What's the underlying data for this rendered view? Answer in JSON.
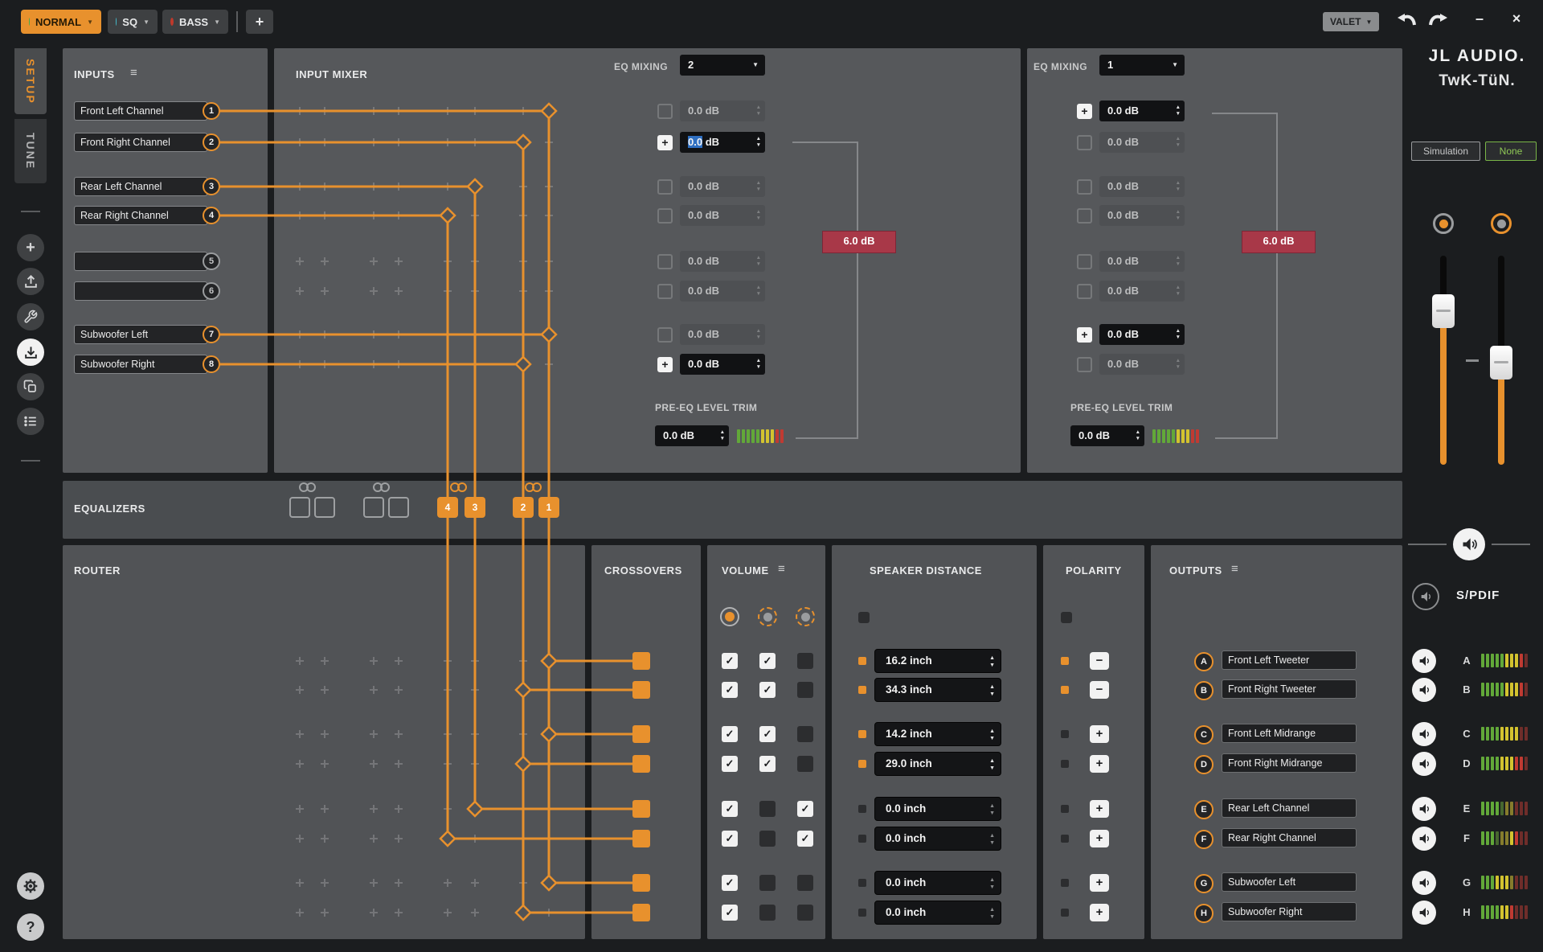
{
  "toolbar": {
    "presets": [
      {
        "label": "NORMAL",
        "dot_color": "#3faa4f",
        "active": true
      },
      {
        "label": "SQ",
        "dot_color": "#45b8c8",
        "active": false
      },
      {
        "label": "BASS",
        "dot_color": "#c0392b",
        "active": false
      }
    ],
    "add_label": "+",
    "valet_label": "VALET"
  },
  "sidebar": {
    "tabs": [
      {
        "label": "SETUP",
        "active": true
      },
      {
        "label": "TUNE",
        "active": false
      }
    ],
    "icons": [
      "add",
      "upload",
      "tools",
      "download",
      "copy",
      "list"
    ],
    "active_icon": "download",
    "bottom_icons": [
      "gear",
      "help"
    ],
    "help_glyph": "?"
  },
  "inputs": {
    "title": "INPUTS",
    "channels": [
      {
        "num": "1",
        "label": "Front Left Channel",
        "connected": true
      },
      {
        "num": "2",
        "label": "Front Right Channel",
        "connected": true
      },
      {
        "num": "3",
        "label": "Rear Left Channel",
        "connected": true
      },
      {
        "num": "4",
        "label": "Rear Right Channel",
        "connected": true
      },
      {
        "num": "5",
        "label": "",
        "connected": false
      },
      {
        "num": "6",
        "label": "",
        "connected": false
      },
      {
        "num": "7",
        "label": "Subwoofer Left",
        "connected": true
      },
      {
        "num": "8",
        "label": "Subwoofer Right",
        "connected": true
      }
    ]
  },
  "mixer": {
    "title": "INPUT MIXER",
    "eq_mixing_label": "EQ MIXING",
    "group_a": {
      "eq_mixing_value": "2",
      "rows": [
        {
          "checked": false,
          "value": "0.0 dB"
        },
        {
          "checked": true,
          "value": "0.0 dB"
        },
        {
          "checked": false,
          "value": "0.0 dB"
        },
        {
          "checked": false,
          "value": "0.0 dB"
        },
        {
          "checked": false,
          "value": "0.0 dB"
        },
        {
          "checked": false,
          "value": "0.0 dB"
        },
        {
          "checked": false,
          "value": "0.0 dB"
        },
        {
          "checked": true,
          "value": "0.0 dB"
        }
      ],
      "selected_num": "0.0",
      "selected_unit": " dB",
      "badge": "6.0 dB",
      "trim_label": "PRE-EQ LEVEL TRIM",
      "trim_value": "0.0 dB"
    },
    "group_b": {
      "eq_mixing_value": "1",
      "rows": [
        {
          "checked": true,
          "value": "0.0 dB"
        },
        {
          "checked": false,
          "value": "0.0 dB"
        },
        {
          "checked": false,
          "value": "0.0 dB"
        },
        {
          "checked": false,
          "value": "0.0 dB"
        },
        {
          "checked": false,
          "value": "0.0 dB"
        },
        {
          "checked": false,
          "value": "0.0 dB"
        },
        {
          "checked": true,
          "value": "0.0 dB"
        },
        {
          "checked": false,
          "value": "0.0 dB"
        }
      ],
      "badge": "6.0 dB",
      "trim_label": "PRE-EQ LEVEL TRIM",
      "trim_value": "0.0 dB"
    }
  },
  "equalizers": {
    "title": "EQUALIZERS",
    "bands": [
      "4",
      "3",
      "2",
      "1"
    ]
  },
  "router": {
    "title": "ROUTER",
    "input_to_eq": {
      "1": "EQ1",
      "2": "EQ2",
      "3": "EQ3",
      "4": "EQ4",
      "7": "EQ1",
      "8": "EQ2"
    },
    "eq_to_outputs": {
      "EQ1": [
        "A",
        "C",
        "G"
      ],
      "EQ2": [
        "B",
        "D",
        "H"
      ],
      "EQ3": [
        "E"
      ],
      "EQ4": [
        "F"
      ]
    }
  },
  "crossovers": {
    "title": "CROSSOVERS"
  },
  "volume": {
    "title": "VOLUME",
    "rows": [
      [
        true,
        true,
        false
      ],
      [
        true,
        true,
        false
      ],
      [
        true,
        true,
        false
      ],
      [
        true,
        true,
        false
      ],
      [
        true,
        false,
        true
      ],
      [
        true,
        false,
        true
      ],
      [
        true,
        false,
        false
      ],
      [
        true,
        false,
        false
      ]
    ],
    "check_glyph": "✓"
  },
  "distance": {
    "title": "SPEAKER DISTANCE",
    "rows": [
      {
        "value": "16.2 inch",
        "active": true
      },
      {
        "value": "34.3 inch",
        "active": true
      },
      {
        "value": "14.2 inch",
        "active": true
      },
      {
        "value": "29.0 inch",
        "active": true
      },
      {
        "value": "0.0 inch",
        "active": false
      },
      {
        "value": "0.0 inch",
        "active": false
      },
      {
        "value": "0.0 inch",
        "active": false
      },
      {
        "value": "0.0 inch",
        "active": false
      }
    ]
  },
  "polarity": {
    "title": "POLARITY",
    "rows": [
      {
        "sign": "−",
        "active": true
      },
      {
        "sign": "−",
        "active": true
      },
      {
        "sign": "+",
        "active": false
      },
      {
        "sign": "+",
        "active": false
      },
      {
        "sign": "+",
        "active": false
      },
      {
        "sign": "+",
        "active": false
      },
      {
        "sign": "+",
        "active": false
      },
      {
        "sign": "+",
        "active": false
      }
    ]
  },
  "outputs": {
    "title": "OUTPUTS",
    "rows": [
      {
        "letter": "A",
        "label": "Front Left Tweeter"
      },
      {
        "letter": "B",
        "label": "Front Right Tweeter"
      },
      {
        "letter": "C",
        "label": "Front Left Midrange"
      },
      {
        "letter": "D",
        "label": "Front Right Midrange"
      },
      {
        "letter": "E",
        "label": "Rear Left Channel"
      },
      {
        "letter": "F",
        "label": "Rear Right Channel"
      },
      {
        "letter": "G",
        "label": "Subwoofer Left"
      },
      {
        "letter": "H",
        "label": "Subwoofer Right"
      }
    ]
  },
  "right_panel": {
    "logo_line1": "JL AUDIO.",
    "logo_line2": "TwK-TüN.",
    "sim_label": "Simulation",
    "none_label": "None",
    "spdif_label": "S/PDIF",
    "accent_orange": "#e8912d",
    "meters": [
      {
        "letter": "A",
        "segments": [
          "#62a839",
          "#62a839",
          "#62a839",
          "#62a839",
          "#62a839",
          "#d3c32f",
          "#d3c32f",
          "#d3c32f",
          "#c03a32",
          "#6f2d2a"
        ]
      },
      {
        "letter": "B",
        "segments": [
          "#62a839",
          "#62a839",
          "#62a839",
          "#62a839",
          "#62a839",
          "#d3c32f",
          "#d3c32f",
          "#d3c32f",
          "#c03a32",
          "#6f2d2a"
        ]
      },
      {
        "letter": "C",
        "segments": [
          "#62a839",
          "#62a839",
          "#62a839",
          "#62a839",
          "#d3c32f",
          "#d3c32f",
          "#d3c32f",
          "#d3c32f",
          "#6f2d2a",
          "#6f2d2a"
        ]
      },
      {
        "letter": "D",
        "segments": [
          "#62a839",
          "#62a839",
          "#62a839",
          "#62a839",
          "#d3c32f",
          "#d3c32f",
          "#d3c32f",
          "#c03a32",
          "#c03a32",
          "#6f2d2a"
        ]
      },
      {
        "letter": "E",
        "segments": [
          "#62a839",
          "#62a839",
          "#62a839",
          "#62a839",
          "#47672f",
          "#867c2c",
          "#867c2c",
          "#6f2d2a",
          "#6f2d2a",
          "#6f2d2a"
        ]
      },
      {
        "letter": "F",
        "segments": [
          "#62a839",
          "#62a839",
          "#62a839",
          "#47672f",
          "#867c2c",
          "#867c2c",
          "#d3c32f",
          "#c03a32",
          "#6f2d2a",
          "#6f2d2a"
        ]
      },
      {
        "letter": "G",
        "segments": [
          "#62a839",
          "#62a839",
          "#62a839",
          "#d3c32f",
          "#d3c32f",
          "#d3c32f",
          "#867c2c",
          "#6f2d2a",
          "#6f2d2a",
          "#6f2d2a"
        ]
      },
      {
        "letter": "H",
        "segments": [
          "#62a839",
          "#62a839",
          "#62a839",
          "#62a839",
          "#d3c32f",
          "#d3c32f",
          "#c03a32",
          "#6f2d2a",
          "#6f2d2a",
          "#6f2d2a"
        ]
      }
    ]
  },
  "trim_meter": [
    "#62a839",
    "#62a839",
    "#62a839",
    "#62a839",
    "#62a839",
    "#d3c32f",
    "#d3c32f",
    "#d3c32f",
    "#c03a32",
    "#c03a32"
  ]
}
